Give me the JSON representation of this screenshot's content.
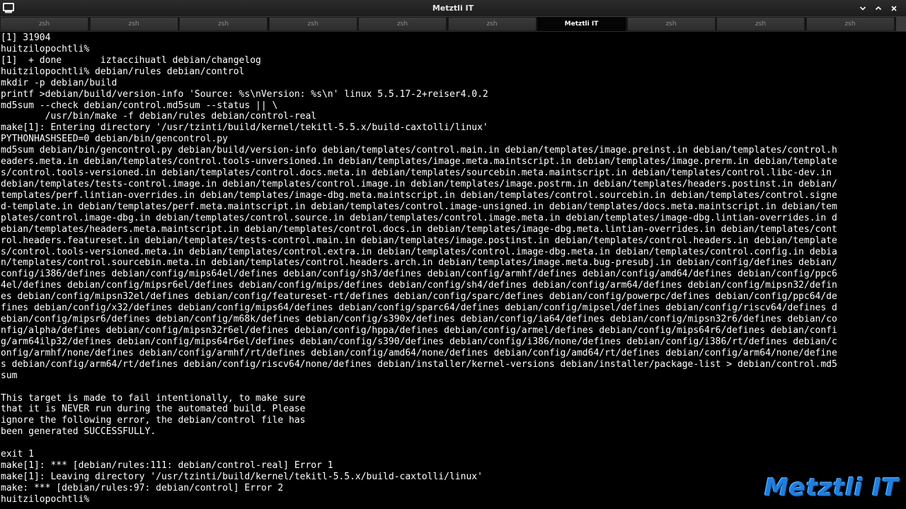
{
  "window": {
    "title": "Metztli IT",
    "icons": {
      "app": "terminal-app-icon",
      "minimize": "chevron-down-icon",
      "maximize": "chevron-up-icon",
      "close": "close-icon"
    }
  },
  "tabs": [
    {
      "label": "zsh",
      "active": false
    },
    {
      "label": "zsh",
      "active": false
    },
    {
      "label": "zsh",
      "active": false
    },
    {
      "label": "zsh",
      "active": false
    },
    {
      "label": "zsh",
      "active": false
    },
    {
      "label": "zsh",
      "active": false
    },
    {
      "label": "Metztli IT",
      "active": true
    },
    {
      "label": "zsh",
      "active": false
    },
    {
      "label": "zsh",
      "active": false
    },
    {
      "label": "zsh",
      "active": false
    }
  ],
  "terminal": {
    "lines": [
      "[1] 31904",
      "huitzilopochtli%",
      "[1]  + done       iztaccihuatl debian/changelog",
      "huitzilopochtli% debian/rules debian/control",
      "mkdir -p debian/build",
      "printf >debian/build/version-info 'Source: %s\\nVersion: %s\\n' linux 5.5.17-2+reiser4.0.2",
      "md5sum --check debian/control.md5sum --status || \\",
      "        /usr/bin/make -f debian/rules debian/control-real",
      "make[1]: Entering directory '/usr/tzinti/build/kernel/tekitl-5.5.x/build-caxtolli/linux'",
      "PYTHONHASHSEED=0 debian/bin/gencontrol.py",
      "md5sum debian/bin/gencontrol.py debian/build/version-info debian/templates/control.main.in debian/templates/image.preinst.in debian/templates/control.h",
      "eaders.meta.in debian/templates/control.tools-unversioned.in debian/templates/image.meta.maintscript.in debian/templates/image.prerm.in debian/template",
      "s/control.tools-versioned.in debian/templates/control.docs.meta.in debian/templates/sourcebin.meta.maintscript.in debian/templates/control.libc-dev.in",
      "debian/templates/tests-control.image.in debian/templates/control.image.in debian/templates/image.postrm.in debian/templates/headers.postinst.in debian/",
      "templates/perf.lintian-overrides.in debian/templates/image-dbg.meta.maintscript.in debian/templates/control.sourcebin.in debian/templates/control.signe",
      "d-template.in debian/templates/perf.meta.maintscript.in debian/templates/control.image-unsigned.in debian/templates/docs.meta.maintscript.in debian/tem",
      "plates/control.image-dbg.in debian/templates/control.source.in debian/templates/control.image.meta.in debian/templates/image-dbg.lintian-overrides.in d",
      "ebian/templates/headers.meta.maintscript.in debian/templates/control.docs.in debian/templates/image-dbg.meta.lintian-overrides.in debian/templates/cont",
      "rol.headers.featureset.in debian/templates/tests-control.main.in debian/templates/image.postinst.in debian/templates/control.headers.in debian/template",
      "s/control.tools-versioned.meta.in debian/templates/control.extra.in debian/templates/control.image-dbg.meta.in debian/templates/control.config.in debia",
      "n/templates/control.sourcebin.meta.in debian/templates/control.headers.arch.in debian/templates/image.meta.bug-presubj.in debian/config/defines debian/",
      "config/i386/defines debian/config/mips64el/defines debian/config/sh3/defines debian/config/armhf/defines debian/config/amd64/defines debian/config/ppc6",
      "4el/defines debian/config/mipsr6el/defines debian/config/mips/defines debian/config/sh4/defines debian/config/arm64/defines debian/config/mipsn32/defin",
      "es debian/config/mipsn32el/defines debian/config/featureset-rt/defines debian/config/sparc/defines debian/config/powerpc/defines debian/config/ppc64/de",
      "fines debian/config/x32/defines debian/config/mips64/defines debian/config/sparc64/defines debian/config/mipsel/defines debian/config/riscv64/defines d",
      "ebian/config/mipsr6/defines debian/config/m68k/defines debian/config/s390x/defines debian/config/ia64/defines debian/config/mipsn32r6/defines debian/co",
      "nfig/alpha/defines debian/config/mipsn32r6el/defines debian/config/hppa/defines debian/config/armel/defines debian/config/mips64r6/defines debian/confi",
      "g/arm64ilp32/defines debian/config/mips64r6el/defines debian/config/s390/defines debian/config/i386/none/defines debian/config/i386/rt/defines debian/c",
      "onfig/armhf/none/defines debian/config/armhf/rt/defines debian/config/amd64/none/defines debian/config/amd64/rt/defines debian/config/arm64/none/define",
      "s debian/config/arm64/rt/defines debian/config/riscv64/none/defines debian/installer/kernel-versions debian/installer/package-list > debian/control.md5",
      "sum",
      "",
      "This target is made to fail intentionally, to make sure",
      "that it is NEVER run during the automated build. Please",
      "ignore the following error, the debian/control file has",
      "been generated SUCCESSFULLY.",
      "",
      "exit 1",
      "make[1]: *** [debian/rules:111: debian/control-real] Error 1",
      "make[1]: Leaving directory '/usr/tzinti/build/kernel/tekitl-5.5.x/build-caxtolli/linux'",
      "make: *** [debian/rules:97: debian/control] Error 2",
      "huitzilopochtli%"
    ],
    "text_color": "#ffffff",
    "background_color": "#000000"
  },
  "watermark": {
    "logo_text": "Metztli IT",
    "logo_color": "#1f7fe0"
  }
}
